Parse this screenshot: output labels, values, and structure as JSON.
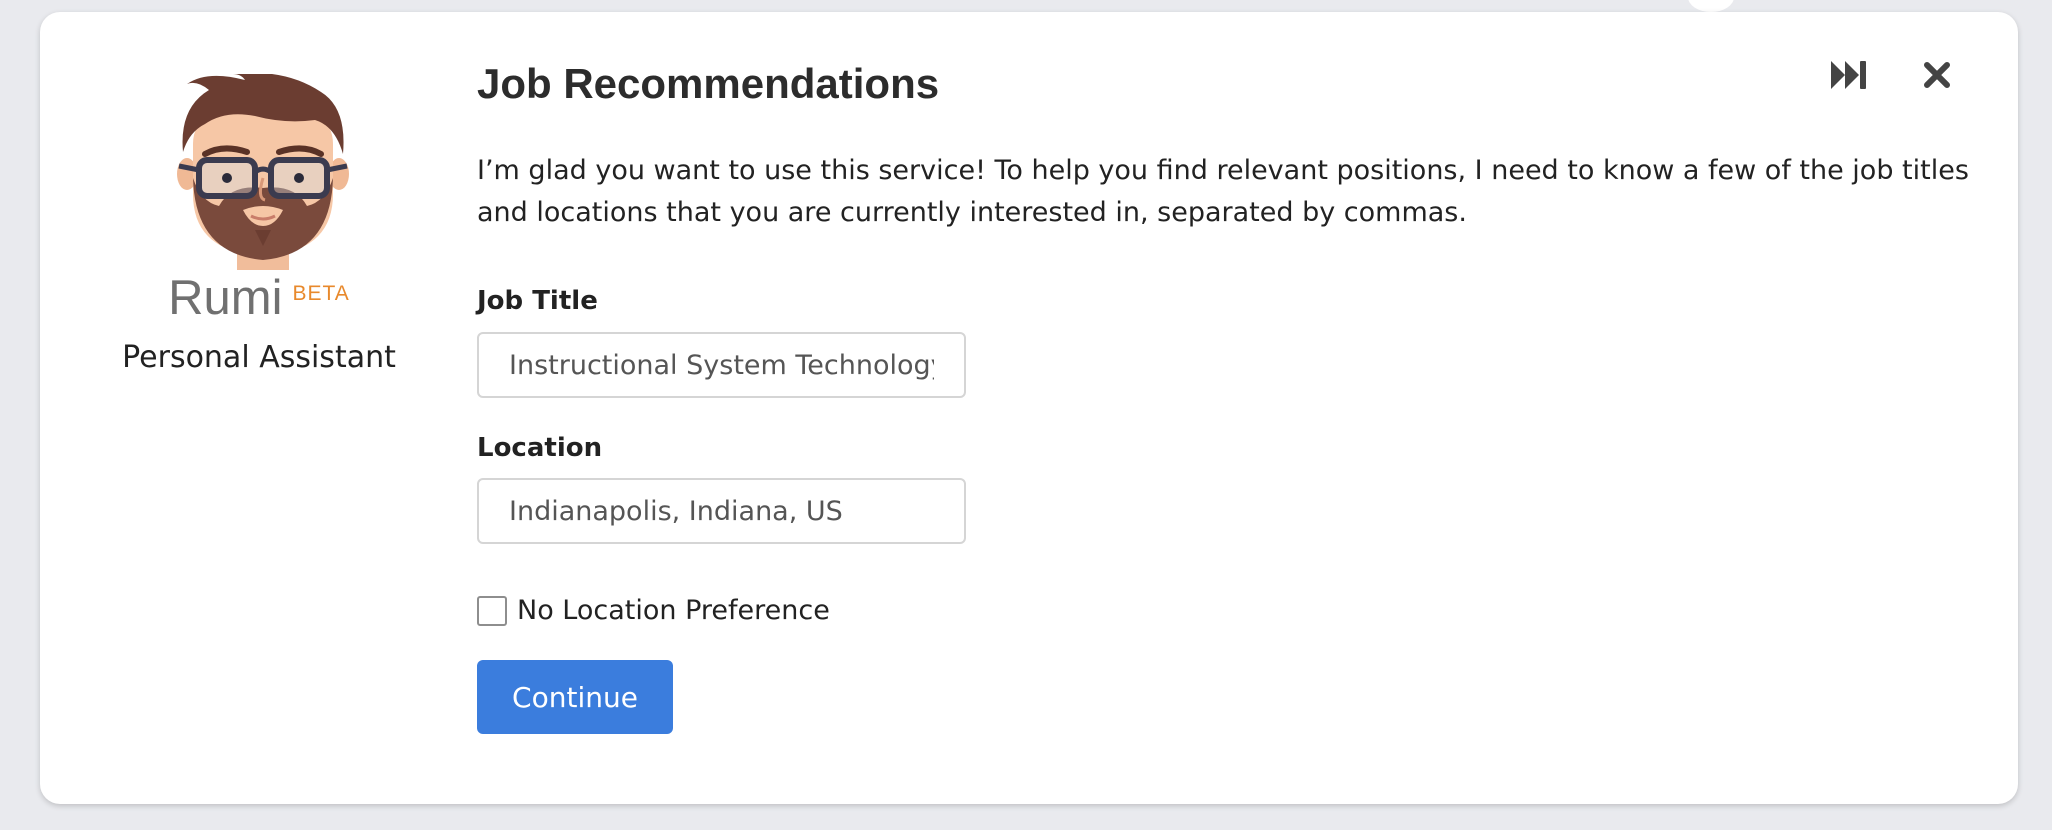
{
  "assistant": {
    "name": "Rumi",
    "badge": "BETA",
    "role": "Personal Assistant",
    "avatar_icon": "bearded-man-avatar"
  },
  "dialog": {
    "title": "Job Recommendations",
    "description": "I’m glad you want to use this service! To help you find relevant positions, I need to know a few of the job titles and locations that you are currently interested in, separated by commas.",
    "skip_icon": "skip-forward-icon",
    "close_icon": "close-icon"
  },
  "form": {
    "job_title": {
      "label": "Job Title",
      "value": "Instructional System Technology"
    },
    "location": {
      "label": "Location",
      "value": "Indianapolis, Indiana, US"
    },
    "no_location_preference": {
      "label": "No Location Preference",
      "checked": false
    },
    "continue_label": "Continue"
  },
  "colors": {
    "background": "#e9eaee",
    "card": "#ffffff",
    "accent": "#3b7ddd",
    "badge": "#e8892c",
    "icon": "#444444"
  }
}
